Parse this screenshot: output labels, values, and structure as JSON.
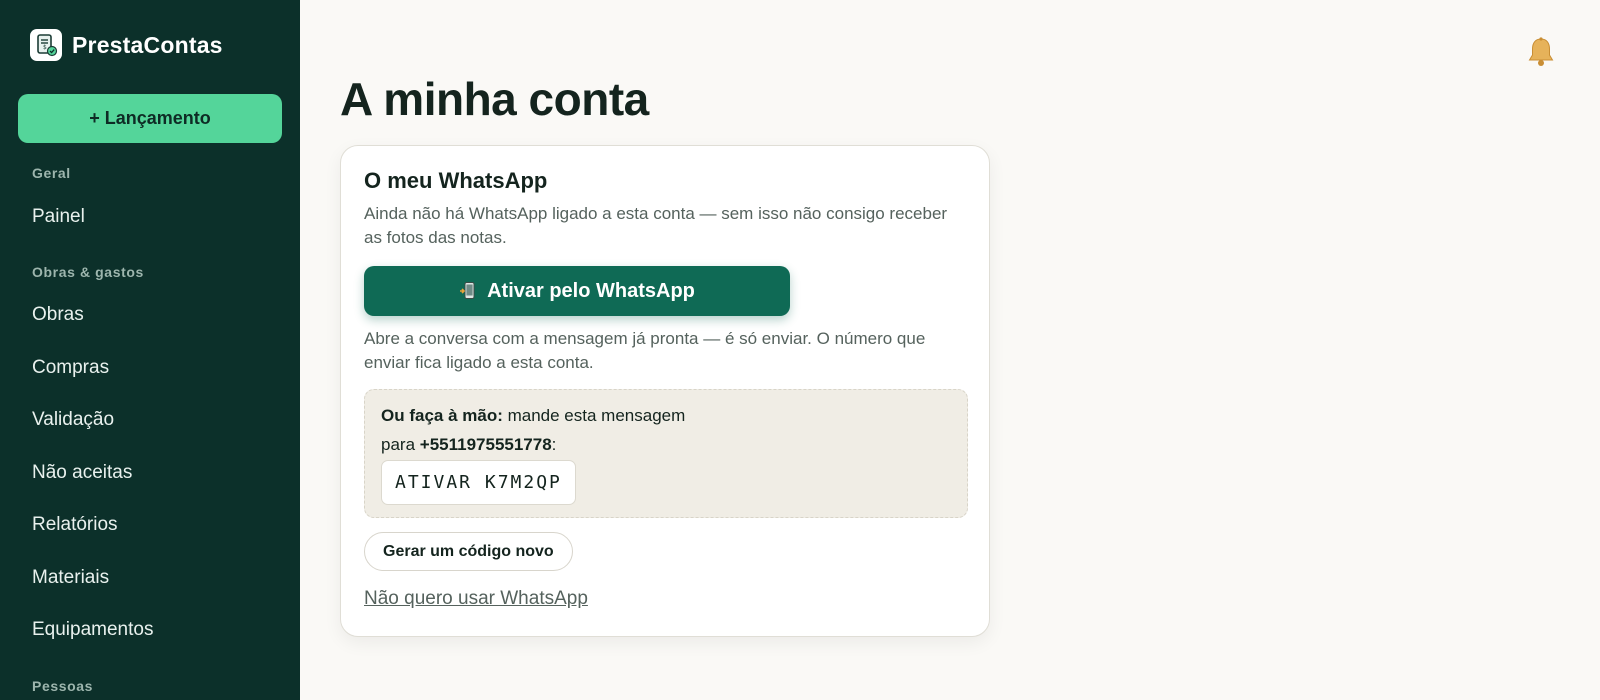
{
  "brand": {
    "name": "PrestaContas",
    "logo_icon": "receipt-logo-icon"
  },
  "sidebar": {
    "new_button": "+ Lançamento",
    "sections": [
      {
        "label": "Geral",
        "items": [
          "Painel"
        ]
      },
      {
        "label": "Obras & gastos",
        "items": [
          "Obras",
          "Compras",
          "Validação",
          "Não aceitas",
          "Relatórios",
          "Materiais",
          "Equipamentos"
        ]
      },
      {
        "label": "Pessoas",
        "items": []
      }
    ]
  },
  "header": {
    "notification_icon": "bell-icon"
  },
  "page": {
    "title": "A minha conta"
  },
  "whatsapp_card": {
    "title": "O meu WhatsApp",
    "description": "Ainda não há WhatsApp ligado a esta conta — sem isso não consigo receber as fotos das notas.",
    "activate_button": "Ativar pelo WhatsApp",
    "activate_icon": "mobile-phone-icon",
    "help_text": "Abre a conversa com a mensagem já pronta — é só enviar. O número que enviar fica ligado a esta conta.",
    "manual": {
      "lead": "Ou faça à mão:",
      "text_1": "mande esta mensagem",
      "text_2": "para",
      "phone": "+5511975551778",
      "suffix": ":",
      "code": "ATIVAR K7M2QP"
    },
    "regenerate_button": "Gerar um código novo",
    "opt_out_link": "Não quero usar WhatsApp"
  },
  "colors": {
    "sidebar_bg": "#0c302a",
    "accent_green": "#54d59a",
    "whatsapp_button": "#0f6a55",
    "bell": "#e0a84a"
  }
}
